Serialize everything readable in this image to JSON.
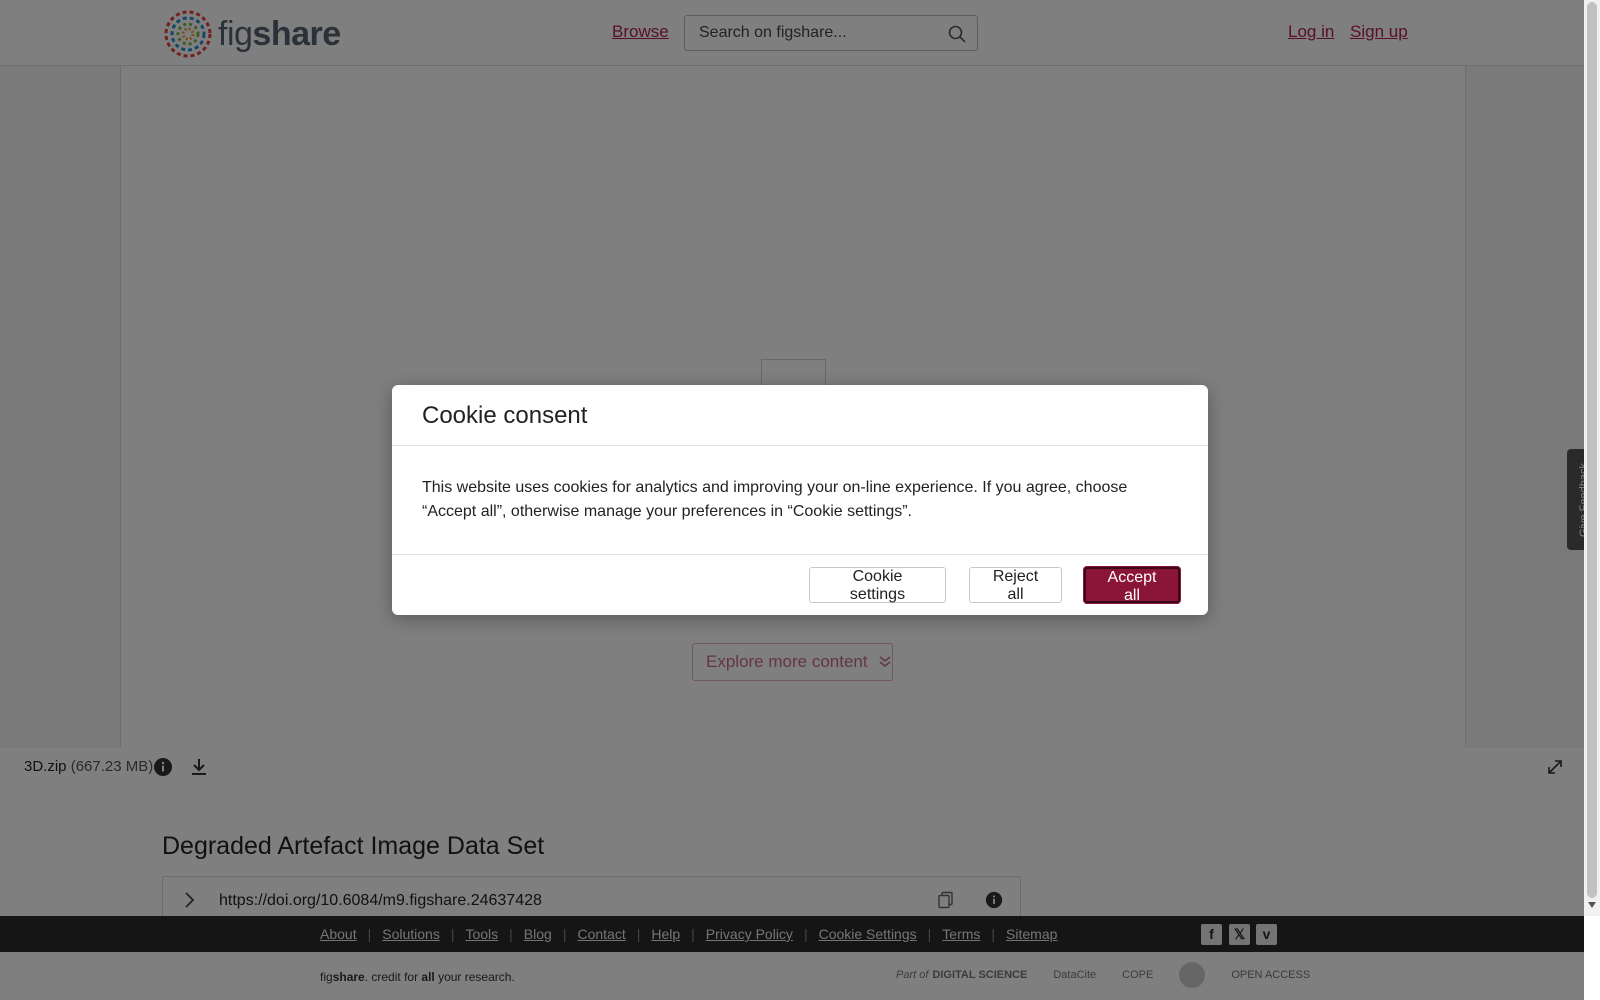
{
  "header": {
    "logo_text_light": "fig",
    "logo_text_bold": "share",
    "browse_label": "Browse",
    "search_placeholder": "Search on figshare...",
    "login_label": "Log in",
    "signup_label": "Sign up"
  },
  "viewer": {
    "explore_label": "Explore more content"
  },
  "file": {
    "name": "3D.zip",
    "size": "(667.23 MB)"
  },
  "main": {
    "title": "Degraded Artefact Image Data Set",
    "doi": "https://doi.org/10.6084/m9.figshare.24637428"
  },
  "footer": {
    "links": [
      "About",
      "Solutions",
      "Tools",
      "Blog",
      "Contact",
      "Help",
      "Privacy Policy",
      "Cookie Settings",
      "Terms",
      "Sitemap"
    ],
    "tagline_fig": "fig",
    "tagline_share": "share",
    "tagline_rest1": ". credit for ",
    "tagline_all": "all",
    "tagline_rest2": " your research.",
    "partner_part_of": "Part of",
    "partner_digital_science": "DIGITAL SCIENCE",
    "partner_datacite": "DataCite",
    "partner_cope": "COPE",
    "partner_open_access": "OPEN ACCESS",
    "social_facebook": "f",
    "social_x": "𝕏",
    "social_vimeo": "v"
  },
  "feedback": {
    "label": "Give Feedback"
  },
  "cookie_modal": {
    "title": "Cookie consent",
    "body": "This website uses cookies for analytics and improving your on-line experience. If you agree, choose “Accept all”, otherwise manage your preferences in “Cookie settings”.",
    "settings_label": "Cookie settings",
    "reject_label": "Reject all",
    "accept_label": "Accept all"
  },
  "colors": {
    "brand": "#b01e57",
    "accept_bg": "#8a1538",
    "footer_bg": "#2b2b2b"
  }
}
